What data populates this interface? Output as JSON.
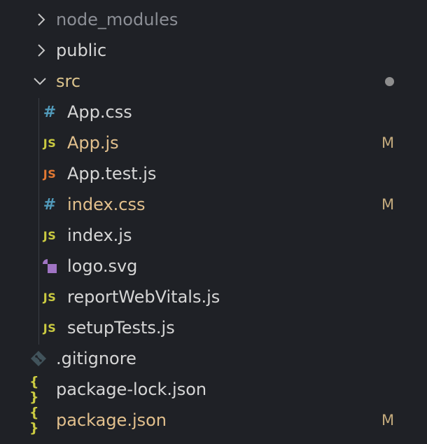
{
  "explorer": {
    "items": [
      {
        "label": "node_modules",
        "kind": "folder",
        "state": "collapsed",
        "style": "dimmed"
      },
      {
        "label": "public",
        "kind": "folder",
        "state": "collapsed"
      },
      {
        "label": "src",
        "kind": "folder",
        "state": "expanded",
        "indicator": "modified-dot"
      },
      {
        "label": "App.css",
        "kind": "file",
        "icon": "#"
      },
      {
        "label": "App.js",
        "kind": "file",
        "icon": "JS",
        "badge": "M"
      },
      {
        "label": "App.test.js",
        "kind": "file",
        "icon": "JS"
      },
      {
        "label": "index.css",
        "kind": "file",
        "icon": "#",
        "badge": "M"
      },
      {
        "label": "index.js",
        "kind": "file",
        "icon": "JS"
      },
      {
        "label": "logo.svg",
        "kind": "file",
        "icon": "svg-shapes-icon"
      },
      {
        "label": "reportWebVitals.js",
        "kind": "file",
        "icon": "JS"
      },
      {
        "label": "setupTests.js",
        "kind": "file",
        "icon": "JS"
      },
      {
        "label": ".gitignore",
        "kind": "file",
        "icon": "git-diamond-icon"
      },
      {
        "label": "package-lock.json",
        "kind": "file",
        "icon": "{ }"
      },
      {
        "label": "package.json",
        "kind": "file",
        "icon": "{ }",
        "badge": "M"
      }
    ]
  },
  "colors": {
    "background": "#1f2126",
    "text": "#d6d6d6",
    "dimmed": "#8c8f96",
    "modified": "#e2c08d",
    "js_icon": "#cbcb41",
    "test_icon": "#e37933",
    "css_icon": "#519aba",
    "svg_icon": "#a074c4",
    "git_icon": "#41535b"
  }
}
